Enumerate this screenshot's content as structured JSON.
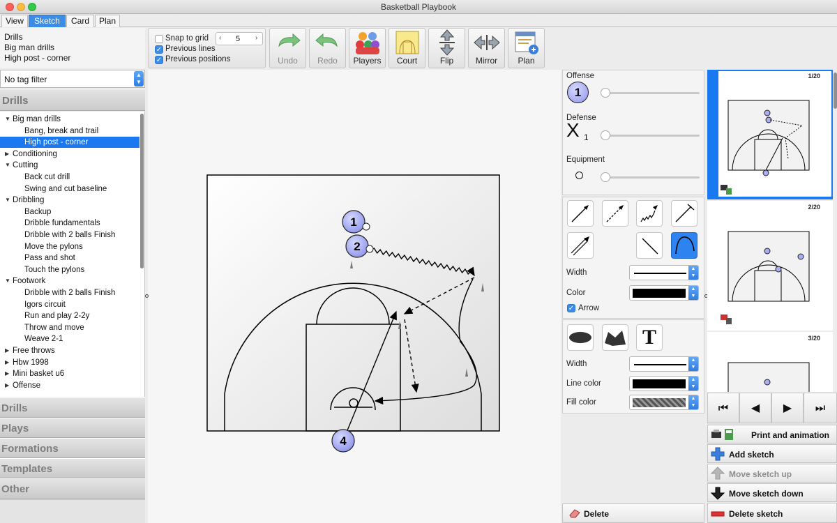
{
  "window": {
    "title": "Basketball Playbook"
  },
  "tabs": [
    {
      "label": "View"
    },
    {
      "label": "Sketch",
      "active": true
    },
    {
      "label": "Card"
    },
    {
      "label": "Plan"
    }
  ],
  "breadcrumb": [
    "Drills",
    "Big man drills",
    "High post - corner"
  ],
  "tag_filter": {
    "value": "No tag filter"
  },
  "drills_header": "Drills",
  "tree": [
    {
      "label": "Big man drills",
      "level": 0,
      "expanded": true
    },
    {
      "label": "Bang, break and trail",
      "level": 1
    },
    {
      "label": "High post - corner",
      "level": 1,
      "selected": true
    },
    {
      "label": "Conditioning",
      "level": 0,
      "expanded": false
    },
    {
      "label": "Cutting",
      "level": 0,
      "expanded": true
    },
    {
      "label": "Back cut drill",
      "level": 1
    },
    {
      "label": "Swing and cut baseline",
      "level": 1
    },
    {
      "label": "Dribbling",
      "level": 0,
      "expanded": true
    },
    {
      "label": "Backup",
      "level": 1
    },
    {
      "label": "Dribble fundamentals",
      "level": 1
    },
    {
      "label": "Dribble with 2 balls  Finish",
      "level": 1
    },
    {
      "label": "Move the pylons",
      "level": 1
    },
    {
      "label": "Pass and shot",
      "level": 1
    },
    {
      "label": "Touch the pylons",
      "level": 1
    },
    {
      "label": "Footwork",
      "level": 0,
      "expanded": true
    },
    {
      "label": "Dribble with 2 balls  Finish",
      "level": 1
    },
    {
      "label": "Igors circuit",
      "level": 1
    },
    {
      "label": "Run and play 2-2y",
      "level": 1
    },
    {
      "label": "Throw and move",
      "level": 1
    },
    {
      "label": "Weave 2-1",
      "level": 1
    },
    {
      "label": "Free throws",
      "level": 0,
      "expanded": false
    },
    {
      "label": "Hbw 1998",
      "level": 0,
      "expanded": false
    },
    {
      "label": "Mini basket u6",
      "level": 0,
      "expanded": false
    },
    {
      "label": "Offense",
      "level": 0,
      "expanded": false
    }
  ],
  "accordion": [
    "Drills",
    "Plays",
    "Formations",
    "Templates",
    "Other"
  ],
  "toolbar": {
    "snap_to_grid": {
      "label": "Snap to grid",
      "checked": false
    },
    "previous_lines": {
      "label": "Previous lines",
      "checked": true
    },
    "previous_positions": {
      "label": "Previous positions",
      "checked": true
    },
    "grid_value": "5",
    "buttons": [
      {
        "label": "Undo",
        "icon": "undo-arrow-icon",
        "enabled": false
      },
      {
        "label": "Redo",
        "icon": "redo-arrow-icon",
        "enabled": false
      },
      {
        "label": "Players",
        "icon": "players-icon",
        "enabled": true
      },
      {
        "label": "Court",
        "icon": "court-icon",
        "enabled": true
      },
      {
        "label": "Flip",
        "icon": "flip-icon",
        "enabled": true
      },
      {
        "label": "Mirror",
        "icon": "mirror-icon",
        "enabled": true
      },
      {
        "label": "Plan",
        "icon": "plan-icon",
        "enabled": true
      }
    ]
  },
  "court": {
    "players": [
      {
        "label": "1",
        "role": "offense"
      },
      {
        "label": "2",
        "role": "offense"
      },
      {
        "label": "4",
        "role": "offense"
      }
    ]
  },
  "right_panel": {
    "offense_label": "Offense",
    "offense_symbol": "1",
    "defense_label": "Defense",
    "defense_symbol": "X",
    "defense_sub": "1",
    "equipment_label": "Equipment",
    "width_label": "Width",
    "color_label": "Color",
    "color_value": "#000000",
    "arrow_label": "Arrow",
    "arrow_checked": true,
    "width2_label": "Width",
    "line_color_label": "Line color",
    "fill_color_label": "Fill color",
    "text_tool_glyph": "T",
    "delete_label": "Delete"
  },
  "thumbnails": [
    {
      "label": "1/20",
      "selected": true
    },
    {
      "label": "2/20",
      "selected": false
    },
    {
      "label": "3/20",
      "selected": false
    }
  ],
  "nav": {
    "first": "⏮",
    "prev": "◀",
    "next": "▶",
    "last": "⏭"
  },
  "actions": {
    "print": "Print and animation",
    "add": "Add sketch",
    "up": "Move sketch up",
    "down": "Move sketch down",
    "delete": "Delete sketch"
  },
  "colors": {
    "accent": "#1a78f0",
    "player_fill": "#a9adf2"
  }
}
